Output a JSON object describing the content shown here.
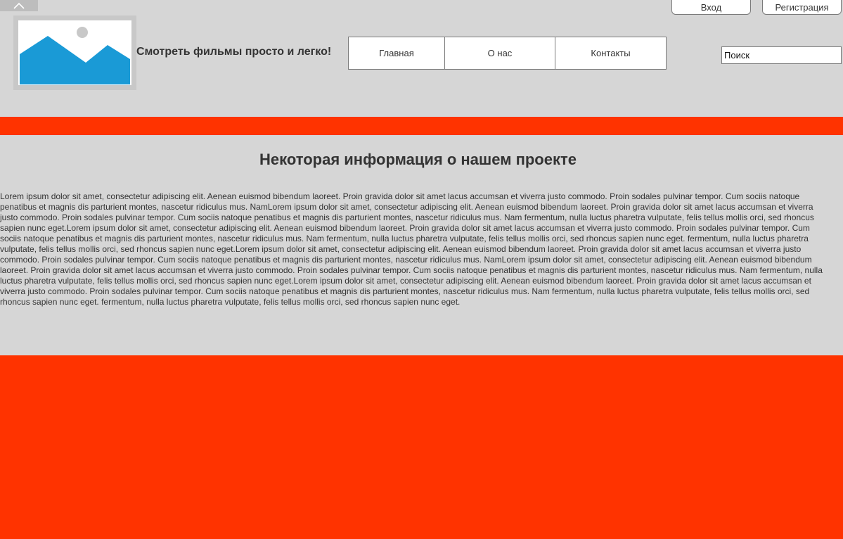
{
  "header": {
    "site_title": "Смотреть фильмы просто и легко!",
    "nav": {
      "items": [
        {
          "label": "Главная"
        },
        {
          "label": "О нас"
        },
        {
          "label": "Контакты"
        }
      ]
    },
    "auth": {
      "login_label": "Вход",
      "register_label": "Регистрация"
    },
    "search": {
      "placeholder": "Поиск"
    },
    "icons": {
      "scroll_top": "chevron-up-icon",
      "logo": "image-placeholder-icon"
    }
  },
  "main": {
    "title": "Некоторая информация о нашем проекте",
    "text": "Lorem ipsum dolor sit amet, consectetur adipiscing elit. Aenean euismod bibendum laoreet. Proin gravida dolor sit amet lacus accumsan et viverra justo commodo. Proin sodales pulvinar tempor. Cum sociis natoque penatibus et magnis dis parturient montes, nascetur ridiculus mus. NamLorem ipsum dolor sit amet, consectetur adipiscing elit. Aenean euismod bibendum laoreet. Proin gravida dolor sit amet lacus accumsan et viverra justo commodo. Proin sodales pulvinar tempor. Cum sociis natoque penatibus et magnis dis parturient montes, nascetur ridiculus mus. Nam fermentum, nulla luctus pharetra vulputate, felis tellus mollis orci, sed rhoncus sapien nunc eget.Lorem ipsum dolor sit amet, consectetur adipiscing elit. Aenean euismod bibendum laoreet. Proin gravida dolor sit amet lacus accumsan et viverra justo commodo. Proin sodales pulvinar tempor. Cum sociis natoque penatibus et magnis dis parturient montes, nascetur ridiculus mus. Nam fermentum, nulla luctus pharetra vulputate, felis tellus mollis orci, sed rhoncus sapien nunc eget. fermentum, nulla luctus pharetra vulputate, felis tellus mollis orci, sed rhoncus sapien nunc eget.Lorem ipsum dolor sit amet, consectetur adipiscing elit. Aenean euismod bibendum laoreet. Proin gravida dolor sit amet lacus accumsan et viverra justo commodo. Proin sodales pulvinar tempor. Cum sociis natoque penatibus et magnis dis parturient montes, nascetur ridiculus mus. NamLorem ipsum dolor sit amet, consectetur adipiscing elit. Aenean euismod bibendum laoreet. Proin gravida dolor sit amet lacus accumsan et viverra justo commodo. Proin sodales pulvinar tempor. Cum sociis natoque penatibus et magnis dis parturient montes, nascetur ridiculus mus. Nam fermentum, nulla luctus pharetra vulputate, felis tellus mollis orci, sed rhoncus sapien nunc eget.Lorem ipsum dolor sit amet, consectetur adipiscing elit. Aenean euismod bibendum laoreet. Proin gravida dolor sit amet lacus accumsan et viverra justo commodo. Proin sodales pulvinar tempor. Cum sociis natoque penatibus et magnis dis parturient montes, nascetur ridiculus mus. Nam fermentum, nulla luctus pharetra vulputate, felis tellus mollis orci, sed rhoncus sapien nunc eget. fermentum, nulla luctus pharetra vulputate, felis tellus mollis orci, sed rhoncus sapien nunc eget."
  },
  "colors": {
    "background": "#d6d6d6",
    "accent": "#ff3300",
    "logo_blue": "#1a9ad6",
    "text": "#333333"
  }
}
